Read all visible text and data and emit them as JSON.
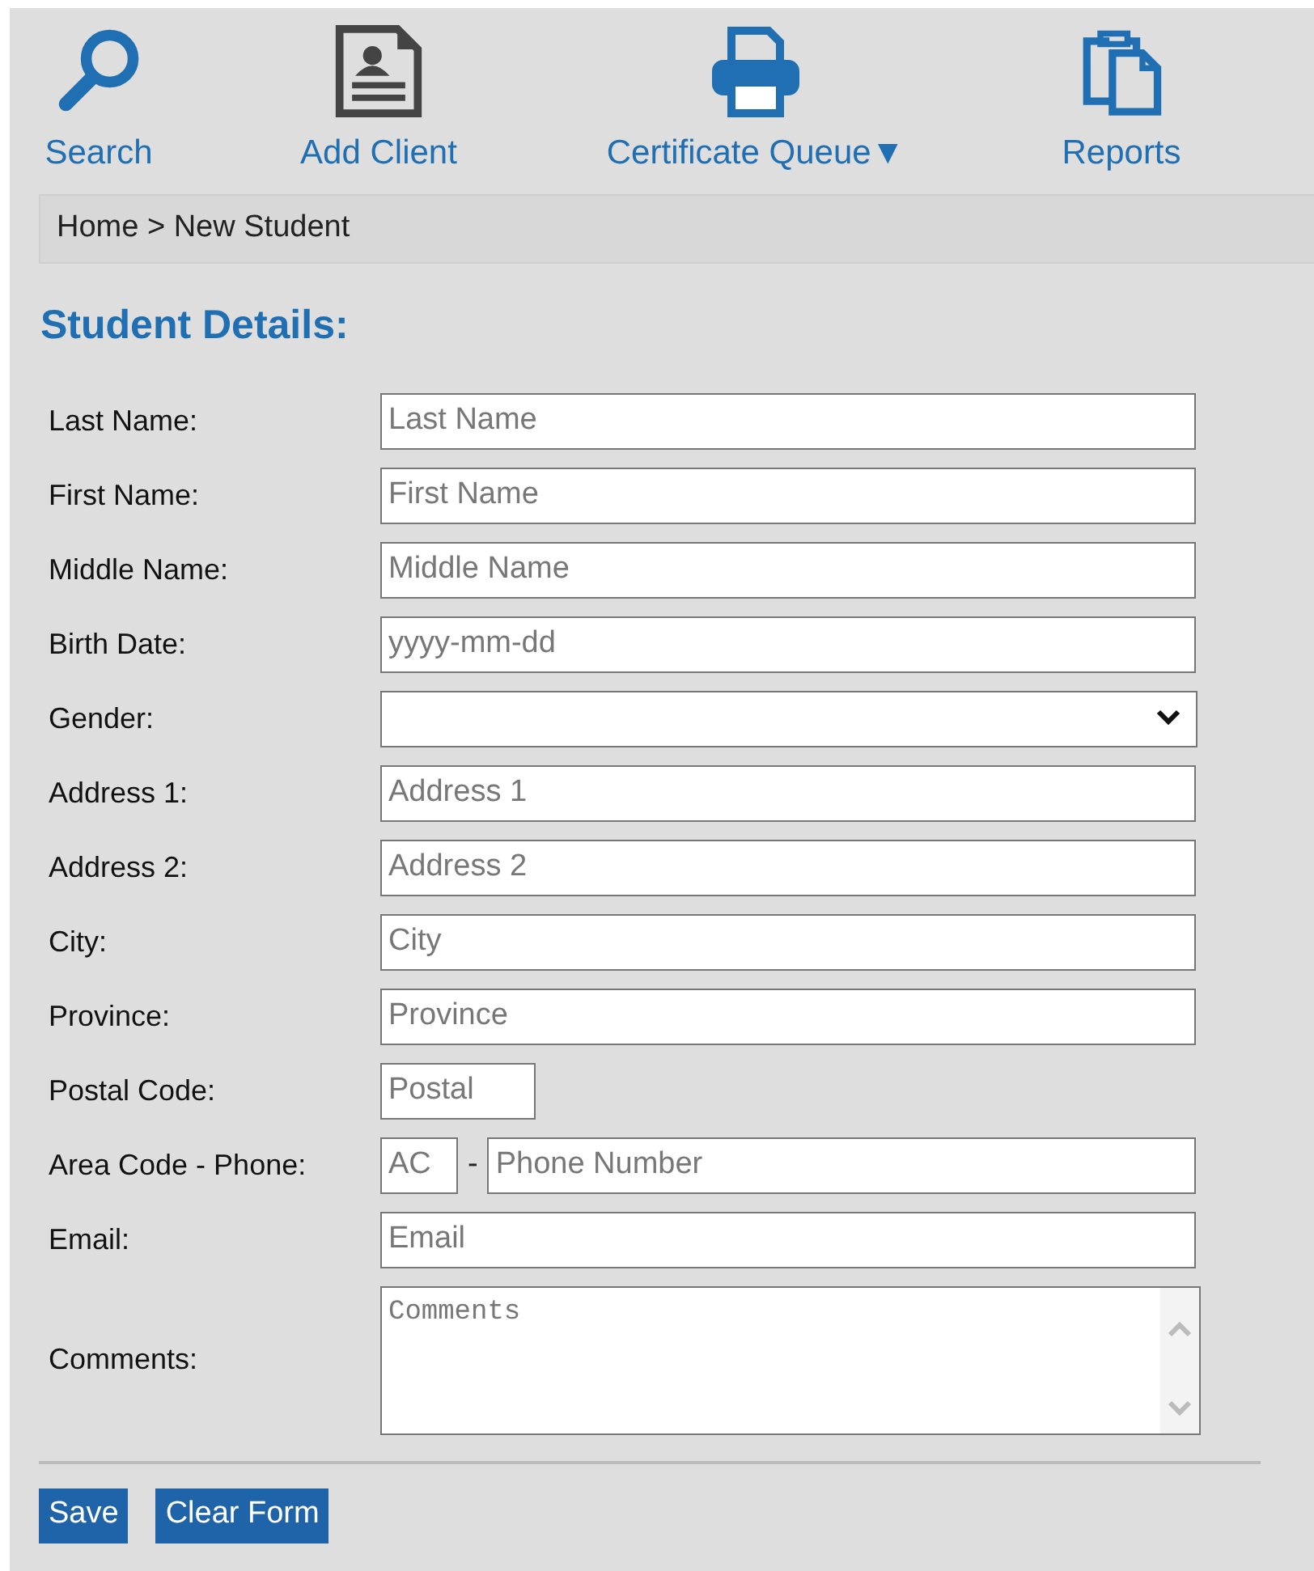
{
  "toolbar": [
    {
      "label": "Search"
    },
    {
      "label": "Add Client"
    },
    {
      "label": "Certificate Queue",
      "caret": "▼"
    },
    {
      "label": "Reports"
    }
  ],
  "breadcrumb": "Home > New Student",
  "heading": "Student Details:",
  "fields": [
    {
      "kind": "text",
      "label": "Last Name:",
      "placeholder": "Last Name"
    },
    {
      "kind": "text",
      "label": "First Name:",
      "placeholder": "First Name"
    },
    {
      "kind": "text",
      "label": "Middle Name:",
      "placeholder": "Middle Name"
    },
    {
      "kind": "text",
      "label": "Birth Date:",
      "placeholder": "yyyy-mm-dd"
    },
    {
      "kind": "select",
      "label": "Gender:"
    },
    {
      "kind": "text",
      "label": "Address 1:",
      "placeholder": "Address 1"
    },
    {
      "kind": "text",
      "label": "Address 2:",
      "placeholder": "Address 2"
    },
    {
      "kind": "text",
      "label": "City:",
      "placeholder": "City"
    },
    {
      "kind": "text",
      "label": "Province:",
      "placeholder": "Province"
    },
    {
      "kind": "short",
      "label": "Postal Code:",
      "placeholder": "Postal"
    },
    {
      "kind": "phone",
      "label": "Area Code - Phone:",
      "placeholder": "AC",
      "separator": "-",
      "placeholder_2": "Phone Number"
    },
    {
      "kind": "text",
      "label": "Email:",
      "placeholder": "Email"
    },
    {
      "kind": "textarea",
      "label": "Comments:",
      "placeholder": "Comments"
    }
  ],
  "buttons": [
    "Save",
    "Clear Form"
  ]
}
